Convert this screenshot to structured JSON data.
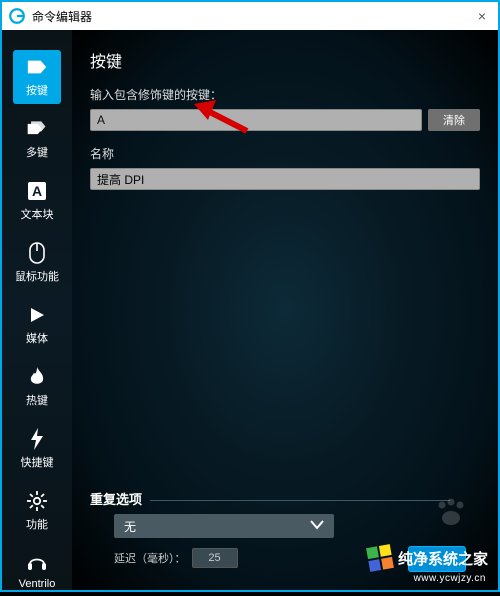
{
  "window": {
    "title": "命令编辑器",
    "close": "×"
  },
  "sidebar": {
    "items": [
      {
        "label": "按键",
        "icon": "tag"
      },
      {
        "label": "多键",
        "icon": "tags"
      },
      {
        "label": "文本块",
        "icon": "text-block"
      },
      {
        "label": "鼠标功能",
        "icon": "mouse"
      },
      {
        "label": "媒体",
        "icon": "play"
      },
      {
        "label": "热键",
        "icon": "flame"
      },
      {
        "label": "快捷键",
        "icon": "lightning"
      },
      {
        "label": "功能",
        "icon": "gear"
      },
      {
        "label": "Ventrilo",
        "icon": "headset"
      }
    ]
  },
  "panel": {
    "heading": "按键",
    "key_input_label": "输入包含修饰键的按键：",
    "key_input_value": "A",
    "clear_button": "清除",
    "name_label": "名称",
    "name_value": "提高 DPI",
    "repeat": {
      "title": "重复选项",
      "mode": "无",
      "delay_label": "延迟（毫秒）：",
      "delay_value": "25"
    }
  },
  "watermark": {
    "text": "纯净系统之家",
    "url": "www.ycwjzy.cn"
  }
}
